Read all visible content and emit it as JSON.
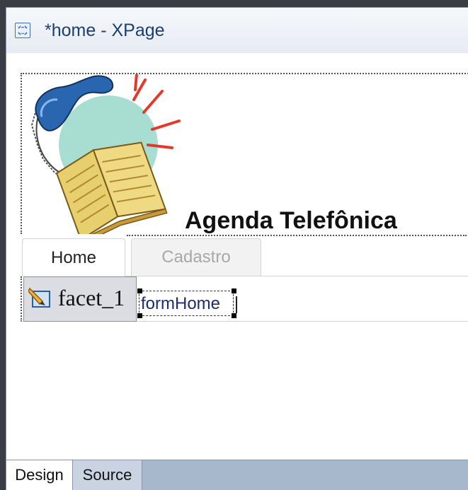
{
  "window": {
    "title": "*home - XPage",
    "icon": "xpage-icon"
  },
  "header": {
    "app_title": "Agenda Telefônica",
    "image": "telephone-book-clipart"
  },
  "tabs": [
    {
      "label": "Home",
      "selected": true
    },
    {
      "label": "Cadastro",
      "selected": false
    }
  ],
  "facet": {
    "label": "facet_1",
    "icon": "pencil-edit-icon"
  },
  "form": {
    "label": "formHome"
  },
  "editor_tabs": [
    {
      "label": "Design",
      "selected": true
    },
    {
      "label": "Source",
      "selected": false
    }
  ],
  "colors": {
    "title_text": "#1c3f73",
    "bottom_bar": "#a7b7cc",
    "inactive_tab_text": "#a8a8a8"
  }
}
